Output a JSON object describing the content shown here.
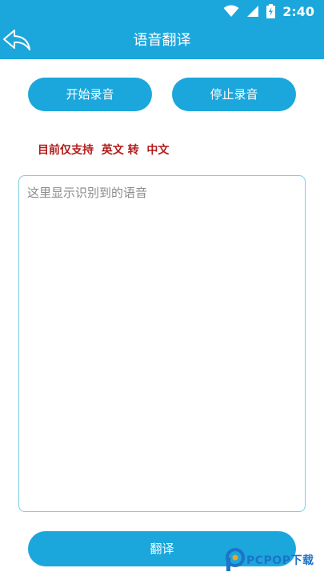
{
  "status_bar": {
    "time": "2:40",
    "icons": [
      "wifi-icon",
      "signal-icon",
      "battery-icon"
    ],
    "background": "#1ba7dc"
  },
  "app_bar": {
    "title": "语音翻译",
    "back_icon": "back-arrow-icon"
  },
  "controls": {
    "start_record_label": "开始录音",
    "stop_record_label": "停止录音"
  },
  "hint_text": "目前仅支持  英文 转  中文",
  "recognition": {
    "placeholder": "这里显示识别到的语音",
    "value": ""
  },
  "translate_label": "翻译",
  "watermark": {
    "text": "PCPOP下载"
  },
  "colors": {
    "accent": "#1ba7dc",
    "hint": "#b31b1b",
    "border": "#7fcbe6"
  }
}
